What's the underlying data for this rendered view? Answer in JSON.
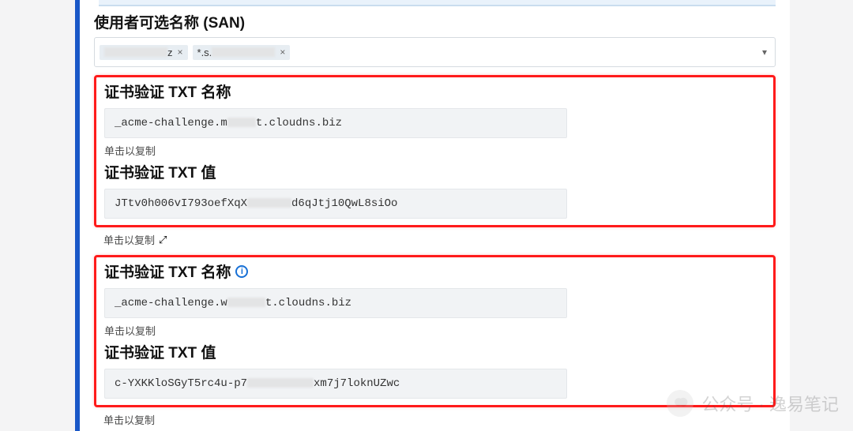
{
  "san": {
    "label": "使用者可选名称 (SAN)",
    "tags": [
      {
        "text": "z",
        "redact_w": 80
      },
      {
        "text": "*.s.",
        "redact_w": 80
      }
    ]
  },
  "records": [
    {
      "name_label": "证书验证 TXT 名称",
      "name_value_prefix": "_acme-challenge.m",
      "name_value_suffix": "t.cloudns.biz",
      "copy_hint": "单击以复制",
      "value_label": "证书验证 TXT 值",
      "value_prefix": "JTtv0h006vI793oefXqX",
      "value_suffix": "d6qJtj10QwL8siOo",
      "copy_hint2": "单击以复制",
      "show_info": false,
      "show_cursor": true
    },
    {
      "name_label": "证书验证 TXT 名称",
      "name_value_prefix": "_acme-challenge.w",
      "name_value_suffix": "t.cloudns.biz",
      "copy_hint": "单击以复制",
      "value_label": "证书验证 TXT 值",
      "value_prefix": "c-YXKKloSGyT5rc4u-p7",
      "value_suffix": "xm7j7loknUZwc",
      "copy_hint2": "单击以复制",
      "show_info": true,
      "show_cursor": false
    }
  ],
  "watermark": {
    "text": "公众号 · 逸易笔记"
  }
}
